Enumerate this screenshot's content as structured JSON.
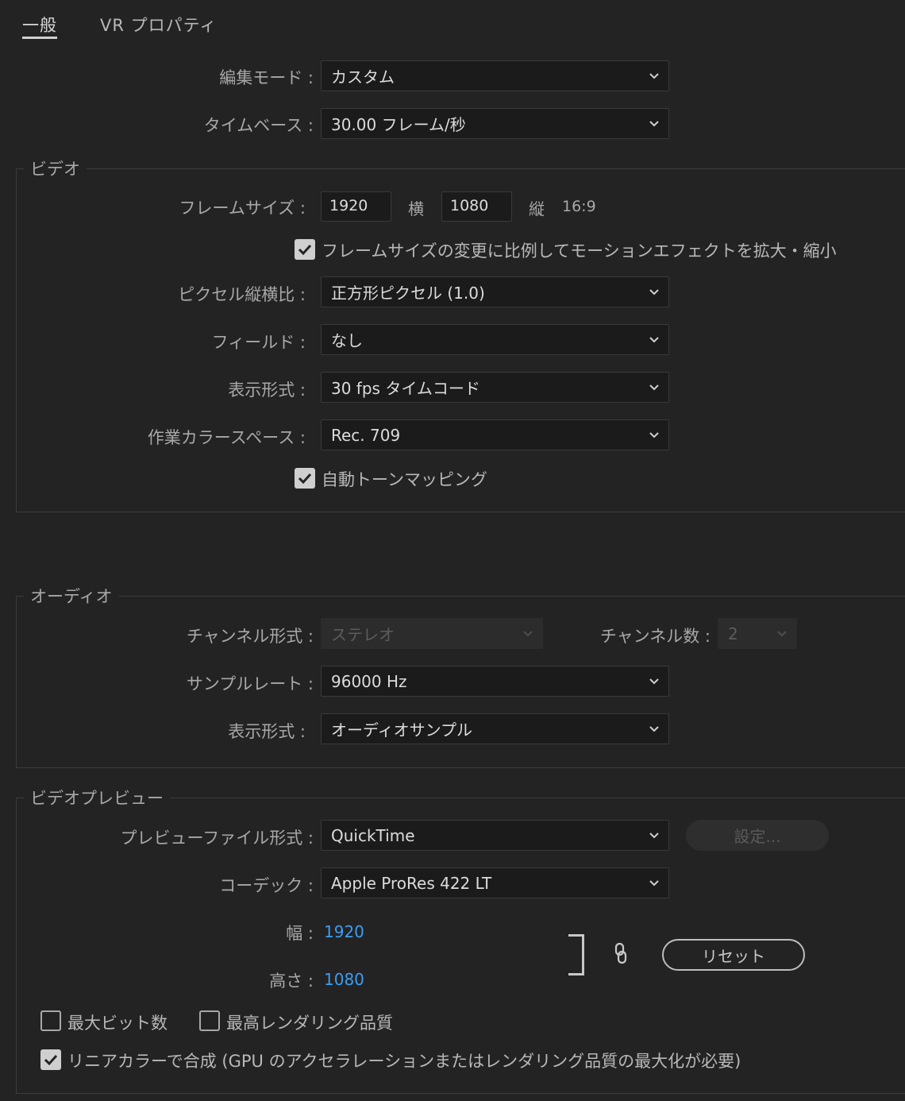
{
  "tabs": [
    {
      "label": "一般"
    },
    {
      "label": "VR プロパティ"
    }
  ],
  "edit_mode": {
    "label": "編集モード :",
    "value": "カスタム"
  },
  "timebase": {
    "label": "タイムベース :",
    "value": "30.00  フレーム/秒"
  },
  "video": {
    "title": "ビデオ",
    "frame_size_label": "フレームサイズ :",
    "width": "1920",
    "width_unit": "横",
    "height": "1080",
    "height_unit": "縦",
    "aspect": "16:9",
    "scale_motion_checkbox": {
      "label": "フレームサイズの変更に比例してモーションエフェクトを拡大・縮小",
      "checked": true
    },
    "pixel_aspect": {
      "label": "ピクセル縦横比 :",
      "value": "正方形ピクセル (1.0)"
    },
    "fields": {
      "label": "フィールド :",
      "value": "なし"
    },
    "display_format": {
      "label": "表示形式 :",
      "value": "30 fps タイムコード"
    },
    "color_space": {
      "label": "作業カラースペース :",
      "value": "Rec. 709"
    },
    "tone_mapping_checkbox": {
      "label": "自動トーンマッピング",
      "checked": true
    }
  },
  "audio": {
    "title": "オーディオ",
    "channel_format": {
      "label": "チャンネル形式 :",
      "value": "ステレオ"
    },
    "channel_count": {
      "label": "チャンネル数 :",
      "value": "2"
    },
    "sample_rate": {
      "label": "サンプルレート :",
      "value": "96000 Hz"
    },
    "display_format": {
      "label": "表示形式 :",
      "value": "オーディオサンプル"
    }
  },
  "video_preview": {
    "title": "ビデオプレビュー",
    "file_format": {
      "label": "プレビューファイル形式 :",
      "value": "QuickTime"
    },
    "settings_button": "設定...",
    "codec": {
      "label": "コーデック :",
      "value": "Apple ProRes 422 LT"
    },
    "width_label": "幅 :",
    "width_value": "1920",
    "height_label": "高さ :",
    "height_value": "1080",
    "reset_button": "リセット",
    "max_bit_depth": {
      "label": "最大ビット数",
      "checked": false
    },
    "max_render_quality": {
      "label": "最高レンダリング品質",
      "checked": false
    },
    "linear_color": {
      "label": "リニアカラーで合成 (GPU のアクセラレーションまたはレンダリング品質の最大化が必要)",
      "checked": true
    }
  },
  "colors": {
    "background": "#232323",
    "accent_link": "#3d9df3",
    "dropdown_bg": "#1b1b1b"
  }
}
